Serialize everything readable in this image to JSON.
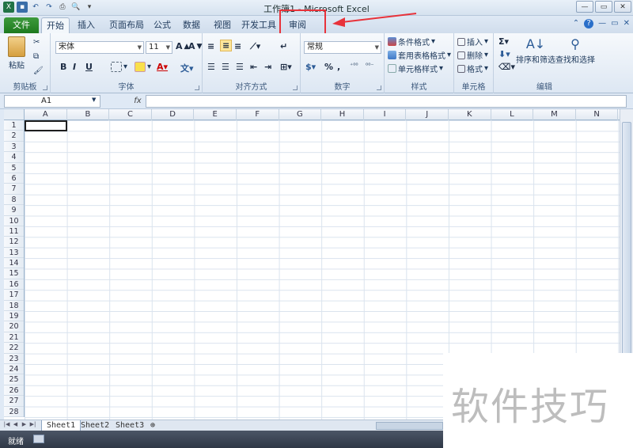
{
  "window": {
    "title": "工作簿1 - Microsoft Excel"
  },
  "ribbon_tabs": [
    "文件",
    "开始",
    "插入",
    "页面布局",
    "公式",
    "数据",
    "视图",
    "开发工具",
    "审阅"
  ],
  "home": {
    "clipboard": {
      "paste_label": "粘贴",
      "group_label": "剪贴板"
    },
    "font": {
      "font_name": "宋体",
      "font_size": "11",
      "group_label": "字体"
    },
    "alignment": {
      "group_label": "对齐方式"
    },
    "number": {
      "format": "常规",
      "group_label": "数字"
    },
    "styles": {
      "conditional": "条件格式",
      "table": "套用表格格式",
      "cell": "单元格样式",
      "group_label": "样式"
    },
    "cells": {
      "insert": "插入",
      "delete": "删除",
      "format": "格式",
      "group_label": "单元格"
    },
    "editing": {
      "sort": "排序和筛选",
      "find": "查找和选择",
      "group_label": "编辑"
    }
  },
  "formula_bar": {
    "name_box": "A1",
    "fx": "fx"
  },
  "columns": [
    "A",
    "B",
    "C",
    "D",
    "E",
    "F",
    "G",
    "H",
    "I",
    "J",
    "K",
    "L",
    "M",
    "N"
  ],
  "rows": [
    "1",
    "2",
    "3",
    "4",
    "5",
    "6",
    "7",
    "8",
    "9",
    "10",
    "11",
    "12",
    "13",
    "14",
    "15",
    "16",
    "17",
    "18",
    "19",
    "20",
    "21",
    "22",
    "23",
    "24",
    "25",
    "26",
    "27",
    "28"
  ],
  "sheets": [
    "Sheet1",
    "Sheet2",
    "Sheet3"
  ],
  "status": {
    "text": "就绪"
  },
  "watermark": "软件技巧",
  "colors": {
    "file_tab": "#2a8a2a",
    "highlight": "#e8323a",
    "statusbar": "#3b4454"
  }
}
